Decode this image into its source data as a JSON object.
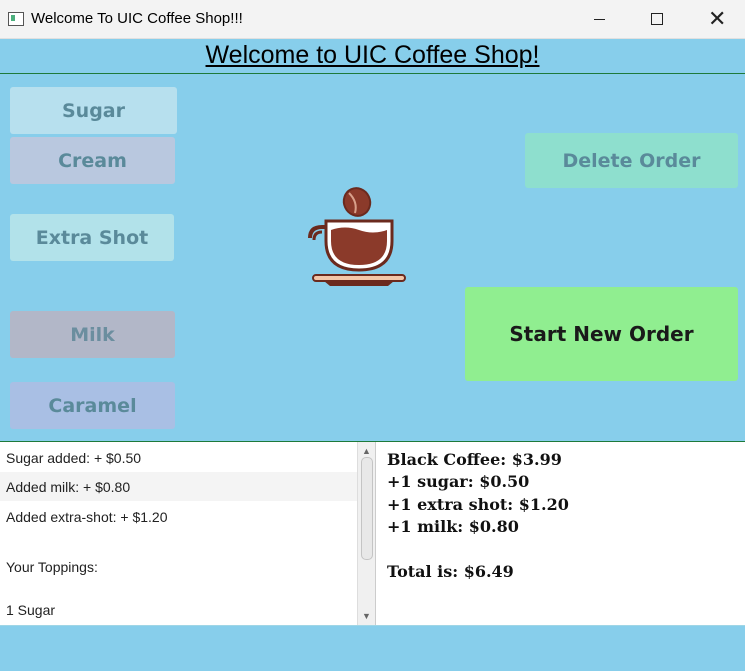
{
  "window": {
    "title": "Welcome To UIC Coffee Shop!!!",
    "controls": [
      "minimize-icon",
      "maximize-icon",
      "close-icon"
    ],
    "close_glyph": "✕"
  },
  "header": {
    "title": "Welcome to UIC Coffee Shop!"
  },
  "toppings": {
    "sugar": "Sugar",
    "cream": "Cream",
    "extra_shot": "Extra Shot",
    "milk": "Milk",
    "caramel": "Caramel"
  },
  "actions": {
    "delete_order": "Delete Order",
    "start_new_order": "Start New Order"
  },
  "log": {
    "items": [
      "Sugar added: + $0.50",
      "Added milk: + $0.80",
      "Added extra-shot: + $1.20",
      "Your Toppings:",
      "1 Sugar"
    ]
  },
  "receipt": {
    "lines": [
      "Black Coffee: $3.99",
      "+1 sugar: $0.50",
      "+1 extra shot: $1.20",
      "+1 milk: $0.80"
    ],
    "total": "Total is: $6.49"
  },
  "colors": {
    "background": "#87CEEB",
    "start_button": "#90EE90",
    "delete_button": "#8EDFCE",
    "coffee": "#8B3A2A"
  },
  "icons": {
    "logo": "coffee-cup-icon"
  }
}
